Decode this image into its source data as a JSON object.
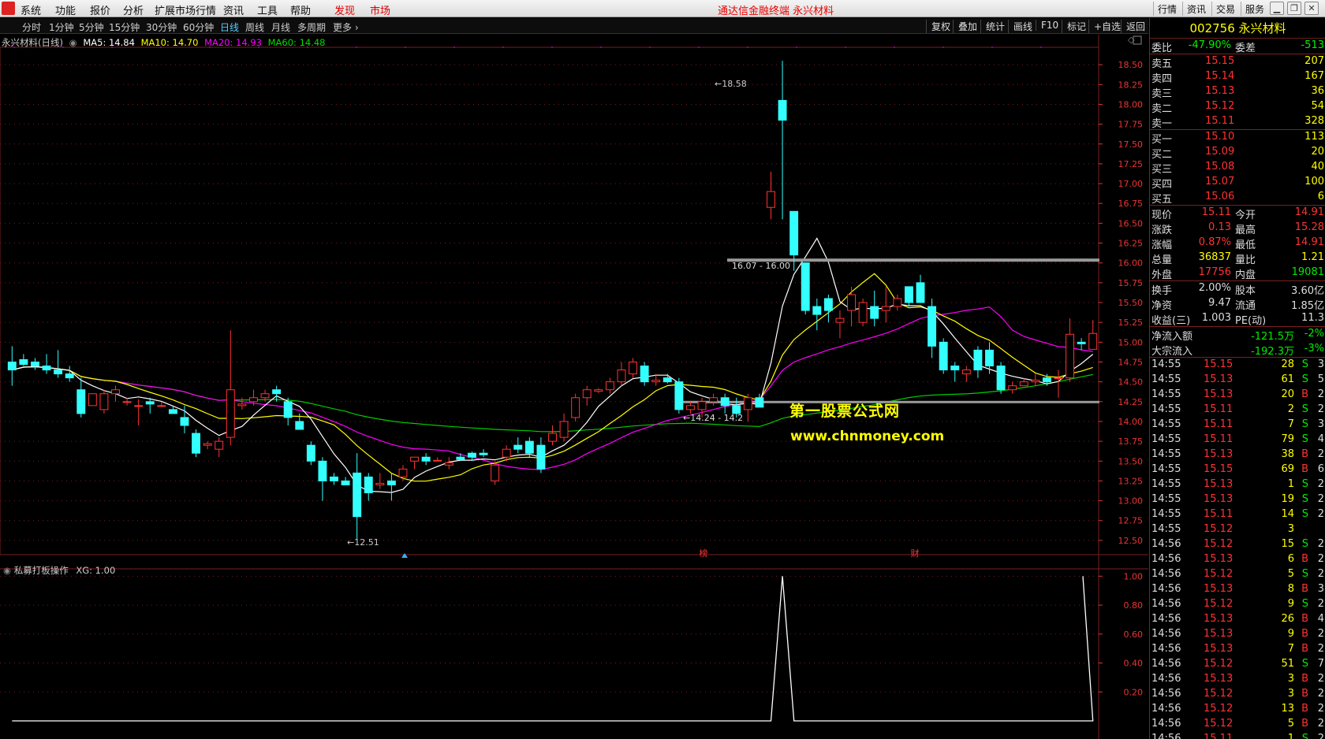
{
  "menu": {
    "items": [
      "系统",
      "功能",
      "报价",
      "分析",
      "扩展市场行情",
      "资讯",
      "工具",
      "帮助"
    ],
    "discover": "发现",
    "market": "市场",
    "title": "通达信金融终端  永兴材料",
    "right_buttons": [
      "行情",
      "资讯",
      "交易",
      "服务"
    ],
    "win": [
      "▁",
      "❐",
      "✕"
    ]
  },
  "periods": [
    "分时",
    "1分钟",
    "5分钟",
    "15分钟",
    "30分钟",
    "60分钟",
    "日线",
    "周线",
    "月线",
    "多周期",
    "更多 ›"
  ],
  "tools": [
    "复权",
    "叠加",
    "统计",
    "画线",
    "F10",
    "标记",
    "+自选",
    "返回"
  ],
  "legend": {
    "name": "永兴材料(日线)",
    "ma5": "MA5: 14.84",
    "ma10": "MA10: 14.70",
    "ma20": "MA20: 14.93",
    "ma60": "MA60: 14.48"
  },
  "indicator": {
    "name": "私募打板操作",
    "value": "XG: 1.00"
  },
  "annotations": {
    "high": "18.58",
    "low": "12.51",
    "band1": "16.07 - 16.00",
    "band2": "14.24 - 14.2",
    "mk1": "榜",
    "mk2": "财"
  },
  "watermark": {
    "line1": "第一股票公式网",
    "line2": "www.chnmoney.com"
  },
  "colors": {
    "up": "#ff3333",
    "down": "#33ffff",
    "ma5": "#ffffff",
    "ma10": "#ffff00",
    "ma20": "#ff00ff",
    "ma60": "#00cc00",
    "grid": "#7a1f1f"
  },
  "chart_data": {
    "type": "candlestick",
    "price_axis": [
      "18.50",
      "18.25",
      "18.00",
      "17.75",
      "17.50",
      "17.25",
      "17.00",
      "16.75",
      "16.50",
      "16.25",
      "16.00",
      "15.75",
      "15.50",
      "15.25",
      "15.00",
      "14.75",
      "14.50",
      "14.25",
      "14.00",
      "13.75",
      "13.50",
      "13.25",
      "13.00",
      "12.75",
      "12.50"
    ],
    "ind_axis": [
      "1.00",
      "0.80",
      "0.60",
      "0.40",
      "0.20"
    ],
    "ylim": [
      12.35,
      18.7
    ],
    "candles": [
      [
        14.75,
        14.95,
        14.45,
        14.65
      ],
      [
        14.78,
        14.85,
        14.7,
        14.72
      ],
      [
        14.75,
        14.8,
        14.65,
        14.7
      ],
      [
        14.7,
        14.85,
        14.6,
        14.65
      ],
      [
        14.65,
        14.9,
        14.55,
        14.6
      ],
      [
        14.6,
        14.7,
        14.5,
        14.55
      ],
      [
        14.4,
        14.55,
        14.05,
        14.1
      ],
      [
        14.2,
        14.35,
        14.2,
        14.35
      ],
      [
        14.15,
        14.4,
        14.1,
        14.35
      ],
      [
        14.35,
        14.45,
        14.25,
        14.4
      ],
      [
        14.25,
        14.3,
        14.2,
        14.25
      ],
      [
        14.2,
        14.28,
        13.95,
        14.2
      ],
      [
        14.25,
        14.3,
        14.1,
        14.22
      ],
      [
        14.2,
        14.25,
        14.18,
        14.2
      ],
      [
        14.15,
        14.2,
        14.1,
        14.1
      ],
      [
        14.05,
        14.2,
        13.85,
        13.95
      ],
      [
        13.85,
        13.9,
        13.55,
        13.6
      ],
      [
        13.7,
        13.75,
        13.65,
        13.72
      ],
      [
        13.65,
        13.8,
        13.55,
        13.75
      ],
      [
        13.8,
        15.15,
        13.7,
        14.4
      ],
      [
        14.2,
        14.3,
        14.15,
        14.22
      ],
      [
        14.25,
        14.4,
        14.2,
        14.3
      ],
      [
        14.3,
        14.4,
        14.25,
        14.35
      ],
      [
        14.4,
        14.45,
        14.25,
        14.35
      ],
      [
        14.25,
        14.3,
        13.95,
        14.05
      ],
      [
        14.0,
        14.1,
        13.95,
        13.9
      ],
      [
        13.7,
        13.75,
        13.45,
        13.5
      ],
      [
        13.5,
        13.55,
        13.0,
        13.25
      ],
      [
        13.3,
        13.35,
        13.2,
        13.25
      ],
      [
        13.25,
        13.3,
        13.2,
        13.2
      ],
      [
        13.35,
        13.6,
        12.52,
        12.8
      ],
      [
        13.3,
        13.35,
        13.0,
        13.1
      ],
      [
        13.2,
        13.35,
        13.15,
        13.22
      ],
      [
        13.25,
        13.35,
        13.0,
        13.2
      ],
      [
        13.3,
        13.45,
        13.25,
        13.4
      ],
      [
        13.5,
        13.55,
        13.4,
        13.55
      ],
      [
        13.55,
        13.6,
        13.45,
        13.5
      ],
      [
        13.5,
        13.55,
        13.5,
        13.51
      ],
      [
        13.45,
        13.55,
        13.4,
        13.48
      ],
      [
        13.55,
        13.6,
        13.5,
        13.52
      ],
      [
        13.6,
        13.62,
        13.5,
        13.55
      ],
      [
        13.6,
        13.65,
        13.55,
        13.58
      ],
      [
        13.25,
        13.5,
        13.2,
        13.45
      ],
      [
        13.55,
        13.7,
        13.5,
        13.65
      ],
      [
        13.7,
        13.8,
        13.6,
        13.65
      ],
      [
        13.75,
        13.8,
        13.55,
        13.6
      ],
      [
        13.7,
        13.8,
        13.35,
        13.4
      ],
      [
        13.75,
        13.95,
        13.7,
        13.85
      ],
      [
        13.8,
        14.1,
        13.75,
        14.0
      ],
      [
        14.05,
        14.35,
        14.0,
        14.3
      ],
      [
        14.3,
        14.45,
        14.2,
        14.4
      ],
      [
        14.38,
        14.42,
        14.36,
        14.4
      ],
      [
        14.4,
        14.55,
        14.35,
        14.5
      ],
      [
        14.5,
        14.75,
        14.45,
        14.65
      ],
      [
        14.6,
        14.8,
        14.55,
        14.75
      ],
      [
        14.7,
        14.75,
        14.45,
        14.5
      ],
      [
        14.5,
        14.6,
        14.45,
        14.52
      ],
      [
        14.55,
        14.6,
        14.48,
        14.5
      ],
      [
        14.5,
        14.55,
        14.1,
        14.15
      ],
      [
        14.15,
        14.25,
        14.1,
        14.2
      ],
      [
        14.15,
        14.3,
        14.05,
        14.25
      ],
      [
        14.25,
        14.35,
        14.2,
        14.3
      ],
      [
        14.3,
        14.35,
        14.1,
        14.2
      ],
      [
        14.2,
        14.3,
        14.05,
        14.1
      ],
      [
        14.15,
        14.35,
        14.0,
        14.3
      ],
      [
        14.3,
        14.35,
        14.2,
        14.18
      ],
      [
        16.7,
        17.15,
        16.55,
        16.9
      ],
      [
        18.05,
        18.55,
        16.55,
        17.8
      ],
      [
        16.65,
        16.65,
        15.9,
        16.1
      ],
      [
        16.0,
        16.0,
        15.35,
        15.4
      ],
      [
        15.45,
        15.55,
        15.15,
        15.35
      ],
      [
        15.55,
        15.6,
        15.25,
        15.4
      ],
      [
        15.25,
        15.4,
        15.05,
        15.3
      ],
      [
        15.4,
        15.7,
        15.2,
        15.6
      ],
      [
        15.25,
        15.55,
        15.2,
        15.5
      ],
      [
        15.45,
        15.65,
        15.2,
        15.3
      ],
      [
        15.4,
        15.7,
        15.25,
        15.45
      ],
      [
        15.45,
        15.6,
        15.4,
        15.55
      ],
      [
        15.7,
        15.7,
        15.45,
        15.5
      ],
      [
        15.75,
        15.85,
        15.65,
        15.5
      ],
      [
        15.45,
        15.55,
        14.8,
        14.95
      ],
      [
        15.0,
        15.05,
        14.6,
        14.65
      ],
      [
        14.7,
        14.75,
        14.5,
        14.65
      ],
      [
        14.6,
        14.7,
        14.5,
        14.65
      ],
      [
        14.9,
        14.95,
        14.55,
        14.65
      ],
      [
        14.9,
        15.0,
        14.6,
        14.7
      ],
      [
        14.7,
        14.75,
        14.35,
        14.4
      ],
      [
        14.4,
        14.5,
        14.35,
        14.45
      ],
      [
        14.45,
        14.55,
        14.45,
        14.5
      ],
      [
        14.5,
        14.6,
        14.45,
        14.52
      ],
      [
        14.55,
        14.6,
        14.45,
        14.5
      ],
      [
        14.55,
        14.65,
        14.3,
        14.55
      ],
      [
        14.55,
        15.3,
        14.5,
        15.1
      ],
      [
        15.0,
        15.05,
        14.9,
        14.98
      ],
      [
        14.91,
        15.28,
        14.91,
        15.11
      ]
    ],
    "indicator_signals": [
      67,
      96
    ]
  },
  "quote": {
    "code_name": "002756 永兴材料",
    "wb": {
      "l1": "委比",
      "v1": "-47.90%",
      "l2": "委差",
      "v2": "-513"
    },
    "asks": [
      [
        "卖五",
        "15.15",
        "207"
      ],
      [
        "卖四",
        "15.14",
        "167"
      ],
      [
        "卖三",
        "15.13",
        "36"
      ],
      [
        "卖二",
        "15.12",
        "54"
      ],
      [
        "卖一",
        "15.11",
        "328"
      ]
    ],
    "bids": [
      [
        "买一",
        "15.10",
        "113"
      ],
      [
        "买二",
        "15.09",
        "20"
      ],
      [
        "买三",
        "15.08",
        "40"
      ],
      [
        "买四",
        "15.07",
        "100"
      ],
      [
        "买五",
        "15.06",
        "6"
      ]
    ],
    "stats": [
      [
        "现价",
        "15.11",
        "今开",
        "14.91",
        "cr",
        "cr"
      ],
      [
        "涨跌",
        "0.13",
        "最高",
        "15.28",
        "cr",
        "cr"
      ],
      [
        "涨幅",
        "0.87%",
        "最低",
        "14.91",
        "cr",
        "cr"
      ],
      [
        "总量",
        "36837",
        "量比",
        "1.21",
        "cyel",
        "cyel"
      ],
      [
        "外盘",
        "17756",
        "内盘",
        "19081",
        "cr",
        "cg"
      ]
    ],
    "fin": [
      [
        "换手",
        "2.00%",
        "股本",
        "3.60亿"
      ],
      [
        "净资",
        "9.47",
        "流通",
        "1.85亿"
      ],
      [
        "收益(三)",
        "1.003",
        "PE(动)",
        "11.3"
      ]
    ],
    "flow": [
      [
        "净流入额",
        "-121.5万",
        "-2%"
      ],
      [
        "大宗流入",
        "-192.3万",
        "-3%"
      ]
    ],
    "ticks": [
      [
        "14:55",
        "15.15",
        "28",
        "S",
        "3"
      ],
      [
        "14:55",
        "15.13",
        "61",
        "S",
        "5"
      ],
      [
        "14:55",
        "15.13",
        "20",
        "B",
        "2"
      ],
      [
        "14:55",
        "15.11",
        "2",
        "S",
        "2"
      ],
      [
        "14:55",
        "15.11",
        "7",
        "S",
        "3"
      ],
      [
        "14:55",
        "15.11",
        "79",
        "S",
        "4"
      ],
      [
        "14:55",
        "15.13",
        "38",
        "B",
        "2"
      ],
      [
        "14:55",
        "15.15",
        "69",
        "B",
        "6"
      ],
      [
        "14:55",
        "15.13",
        "1",
        "S",
        "2"
      ],
      [
        "14:55",
        "15.13",
        "19",
        "S",
        "2"
      ],
      [
        "14:55",
        "15.11",
        "14",
        "S",
        "2"
      ],
      [
        "14:55",
        "15.12",
        "3",
        "",
        ""
      ],
      [
        "14:56",
        "15.12",
        "15",
        "S",
        "2"
      ],
      [
        "14:56",
        "15.13",
        "6",
        "B",
        "2"
      ],
      [
        "14:56",
        "15.12",
        "5",
        "S",
        "2"
      ],
      [
        "14:56",
        "15.13",
        "8",
        "B",
        "3"
      ],
      [
        "14:56",
        "15.12",
        "9",
        "S",
        "2"
      ],
      [
        "14:56",
        "15.13",
        "26",
        "B",
        "4"
      ],
      [
        "14:56",
        "15.13",
        "9",
        "B",
        "2"
      ],
      [
        "14:56",
        "15.13",
        "7",
        "B",
        "2"
      ],
      [
        "14:56",
        "15.12",
        "51",
        "S",
        "7"
      ],
      [
        "14:56",
        "15.13",
        "3",
        "B",
        "2"
      ],
      [
        "14:56",
        "15.12",
        "3",
        "B",
        "2"
      ],
      [
        "14:56",
        "15.12",
        "13",
        "B",
        "2"
      ],
      [
        "14:56",
        "15.12",
        "5",
        "B",
        "2"
      ],
      [
        "14:56",
        "15.11",
        "1",
        "S",
        "2"
      ]
    ]
  }
}
